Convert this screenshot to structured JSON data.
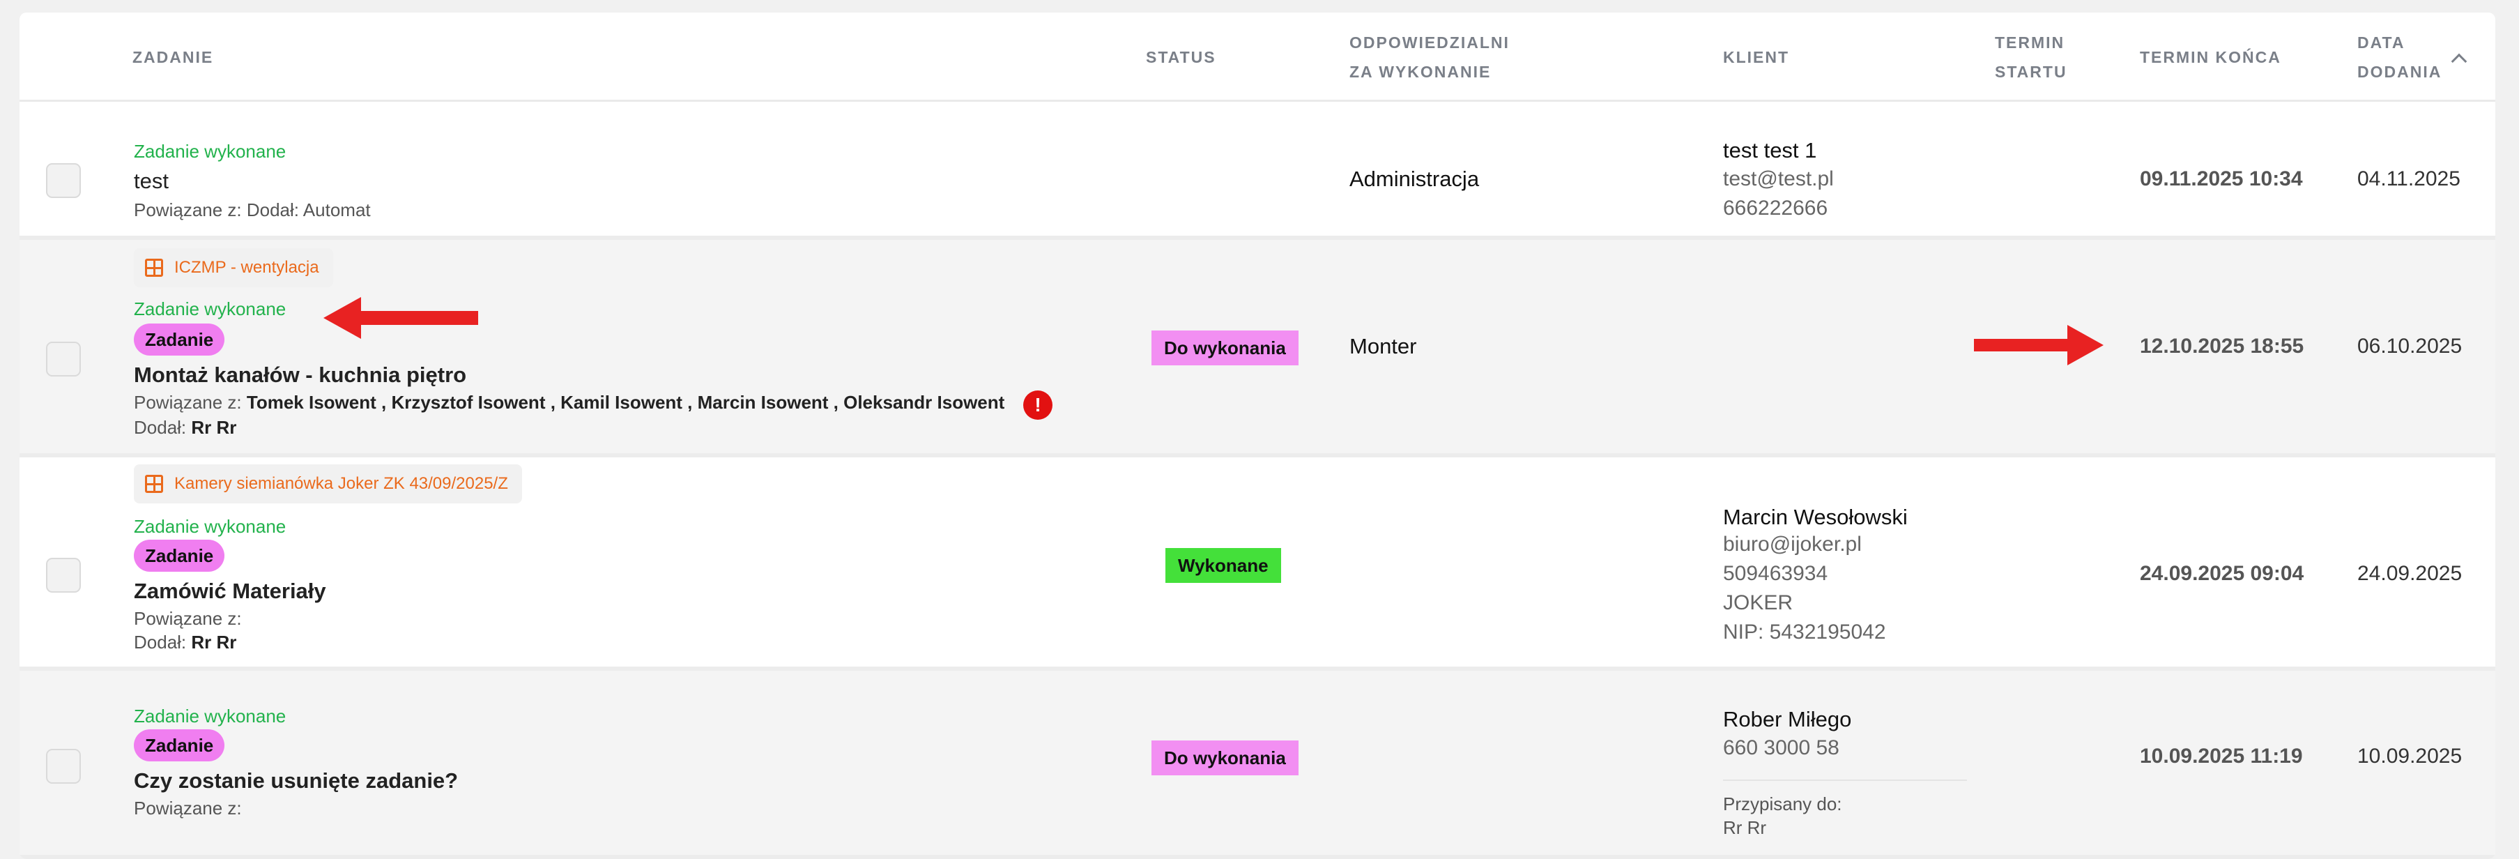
{
  "headers": {
    "task": "ZADANIE",
    "status": "STATUS",
    "responsible_1": "ODPOWIEDZIALNI",
    "responsible_2": "ZA WYKONANIE",
    "client": "KLIENT",
    "start_1": "TERMIN",
    "start_2": "STARTU",
    "end": "TERMIN KOŃCA",
    "added_1": "DATA",
    "added_2": "DODANIA"
  },
  "rows": [
    {
      "task_status": "Zadanie wykonane",
      "title": "test",
      "linked": "Powiązane z: Dodał: Automat",
      "responsible": "Administracja",
      "client_name": "test test 1",
      "client_email": "test@test.pl",
      "client_phone": "666222666",
      "end": "09.11.2025 10:34",
      "added": "04.11.2025"
    },
    {
      "project": "ICZMP - wentylacja",
      "task_status": "Zadanie wykonane",
      "tag": "Zadanie",
      "title": "Montaż kanałów - kuchnia piętro",
      "linked_label": "Powiązane z:",
      "linked_people": "Tomek Isowent , Krzysztof Isowent , Kamil Isowent , Marcin Isowent , Oleksandr Isowent",
      "warning": "!",
      "added_by_label": "Dodał:",
      "added_by": "Rr Rr",
      "status": "Do wykonania",
      "responsible": "Monter",
      "end": "12.10.2025 18:55",
      "added": "06.10.2025"
    },
    {
      "project": "Kamery siemianówka Joker ZK 43/09/2025/Z",
      "task_status": "Zadanie wykonane",
      "tag": "Zadanie",
      "title": "Zamówić Materiały",
      "linked_label": "Powiązane z:",
      "added_by_label": "Dodał:",
      "added_by": "Rr Rr",
      "status": "Wykonane",
      "client_name": "Marcin Wesołowski",
      "client_email": "biuro@ijoker.pl",
      "client_phone": "509463934",
      "client_company": "JOKER",
      "client_nip": "NIP: 5432195042",
      "end": "24.09.2025 09:04",
      "added": "24.09.2025"
    },
    {
      "task_status": "Zadanie wykonane",
      "tag": "Zadanie",
      "title": "Czy zostanie usunięte zadanie?",
      "linked_label": "Powiązane z:",
      "status": "Do wykonania",
      "client_name": "Rober Miłego",
      "client_phone": "660 3000 58",
      "assigned_label": "Przypisany do:",
      "assigned": "Rr Rr",
      "end": "10.09.2025 11:19",
      "added": "10.09.2025"
    }
  ],
  "colors": {
    "done_text": "#22b24c",
    "tag_pink": "#f07ef0",
    "status_pink": "#f28ff2",
    "status_green": "#44e03a",
    "project_orange": "#ea6a1c",
    "warning_red": "#e21111",
    "annotation_arrow": "#e82222"
  },
  "icons": {
    "project": "grid-icon",
    "warning": "exclamation-icon",
    "sort": "chevron-up-icon"
  }
}
